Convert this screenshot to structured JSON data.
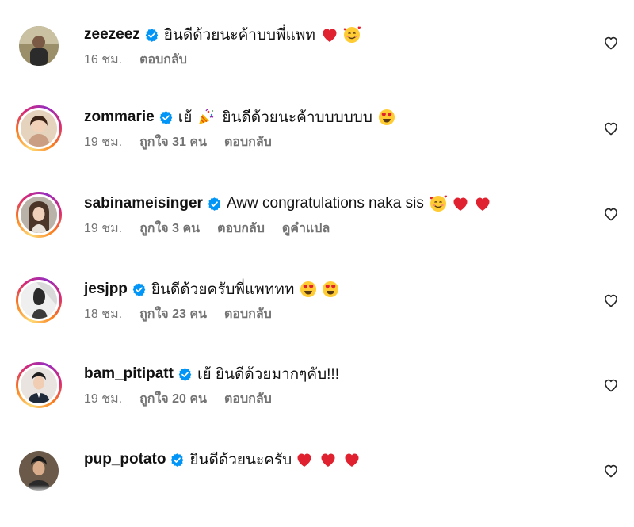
{
  "comments": [
    {
      "username": "zeezeez",
      "verified": true,
      "text": "ยินดีด้วยนะค้าบบพี่แพท",
      "trailing_emojis": [
        "red-heart",
        "smiling-face-with-hearts"
      ],
      "time": "16 ชม.",
      "likes": "",
      "reply_label": "ตอบกลับ",
      "translate_label": "",
      "story_ring": false
    },
    {
      "username": "zommarie",
      "verified": true,
      "text_prefix": "เย้",
      "prefix_emoji": "party-popper",
      "text": "ยินดีด้วยนะค้าบบบบบบ",
      "trailing_emojis": [
        "heart-eyes"
      ],
      "time": "19 ชม.",
      "likes": "ถูกใจ 31 คน",
      "reply_label": "ตอบกลับ",
      "translate_label": "",
      "story_ring": true
    },
    {
      "username": "sabinameisinger",
      "verified": true,
      "text": "Aww congratulations naka sis",
      "trailing_emojis": [
        "smiling-face-with-hearts",
        "red-heart",
        "red-heart"
      ],
      "time": "19 ชม.",
      "likes": "ถูกใจ 3 คน",
      "reply_label": "ตอบกลับ",
      "translate_label": "ดูคำแปล",
      "story_ring": true
    },
    {
      "username": "jesjpp",
      "verified": true,
      "text": "ยินดีด้วยครับพี่แพททท",
      "trailing_emojis": [
        "heart-eyes",
        "heart-eyes"
      ],
      "time": "18 ชม.",
      "likes": "ถูกใจ 23 คน",
      "reply_label": "ตอบกลับ",
      "translate_label": "",
      "story_ring": true
    },
    {
      "username": "bam_pitipatt",
      "verified": true,
      "text": "เย้ ยินดีด้วยมากๆคับ!!!",
      "trailing_emojis": [],
      "time": "19 ชม.",
      "likes": "ถูกใจ 20 คน",
      "reply_label": "ตอบกลับ",
      "translate_label": "",
      "story_ring": true
    },
    {
      "username": "pup_potato",
      "verified": true,
      "text": "ยินดีด้วยนะครับ",
      "trailing_emojis": [
        "red-heart",
        "red-heart",
        "red-heart"
      ],
      "time": "",
      "likes": "",
      "reply_label": "",
      "translate_label": "",
      "story_ring": false
    }
  ],
  "icons": {
    "like": "heart-outline-icon",
    "verified": "verified-badge-icon"
  },
  "colors": {
    "verified_blue": "#0095f6",
    "meta_gray": "#737373",
    "heart_red": "#e0212f",
    "story_ring": "#d62976"
  }
}
